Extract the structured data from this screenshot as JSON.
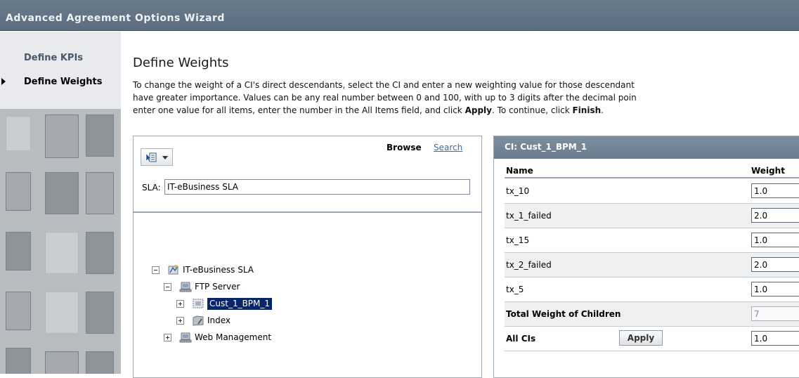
{
  "window": {
    "title": "Advanced Agreement Options Wizard"
  },
  "sidebar": {
    "items": [
      {
        "label": "Define KPIs",
        "active": false
      },
      {
        "label": "Define Weights",
        "active": true
      }
    ]
  },
  "main": {
    "heading": "Define Weights",
    "instructions": {
      "line1": "To change the weight of a CI's direct descendants, select the CI and enter a new weighting value for those descendant",
      "line2": "have greater importance. Values can be any real number between 0 and 100, with up to 3 digits after the decimal poin",
      "line3_a": "enter one value for all items, enter the number in the All Items field, and click ",
      "line3_b": "Apply",
      "line3_c": ". To continue, click ",
      "line3_d": "Finish",
      "line3_e": "."
    }
  },
  "tree_panel": {
    "tool_icon": "view-selector-icon",
    "browse_label": "Browse",
    "search_label": "Search",
    "sla_label": "SLA:",
    "sla_value": "IT-eBusiness SLA",
    "nodes": [
      {
        "label": "IT-eBusiness SLA",
        "expanded": true,
        "icon": "sla-icon"
      },
      {
        "label": "FTP Server",
        "expanded": true,
        "icon": "server-icon"
      },
      {
        "label": "Cust_1_BPM_1",
        "expanded": false,
        "selected": true,
        "icon": "bpm-icon"
      },
      {
        "label": "Index",
        "expanded": false,
        "icon": "index-icon"
      },
      {
        "label": "Web Management",
        "expanded": false,
        "icon": "server-icon"
      }
    ]
  },
  "weights_panel": {
    "header": "CI: Cust_1_BPM_1",
    "col_name": "Name",
    "col_weight": "Weight",
    "rows": [
      {
        "name": "tx_10",
        "weight": "1.0"
      },
      {
        "name": "tx_1_failed",
        "weight": "2.0"
      },
      {
        "name": "tx_15",
        "weight": "1.0"
      },
      {
        "name": "tx_2_failed",
        "weight": "2.0"
      },
      {
        "name": "tx_5",
        "weight": "1.0"
      }
    ],
    "total_label": "Total Weight of Children",
    "total_value": "7",
    "all_label": "All CIs",
    "apply_label": "Apply",
    "all_value": "1.0"
  },
  "colors": {
    "titlebar": "#5b6d7f",
    "selection": "#0a246a",
    "link": "#3b6ea5"
  }
}
